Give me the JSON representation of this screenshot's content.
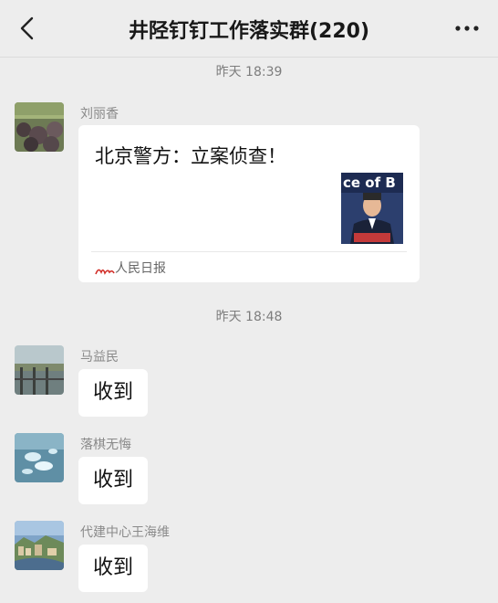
{
  "header": {
    "title": "井陉钉钉工作落实群(220)"
  },
  "messages": {
    "time_1": "昨天 18:39",
    "time_2": "昨天 18:48",
    "msg1": {
      "sender": "刘丽香",
      "link_title": "北京警方：立案侦查！",
      "thumb_text": "ce of B",
      "source": "人民日报"
    },
    "msg2": {
      "sender": "马益民",
      "text": "收到"
    },
    "msg3": {
      "sender": "落棋无悔",
      "text": "收到"
    },
    "msg4": {
      "sender": "代建中心王海维",
      "text": "收到"
    }
  }
}
